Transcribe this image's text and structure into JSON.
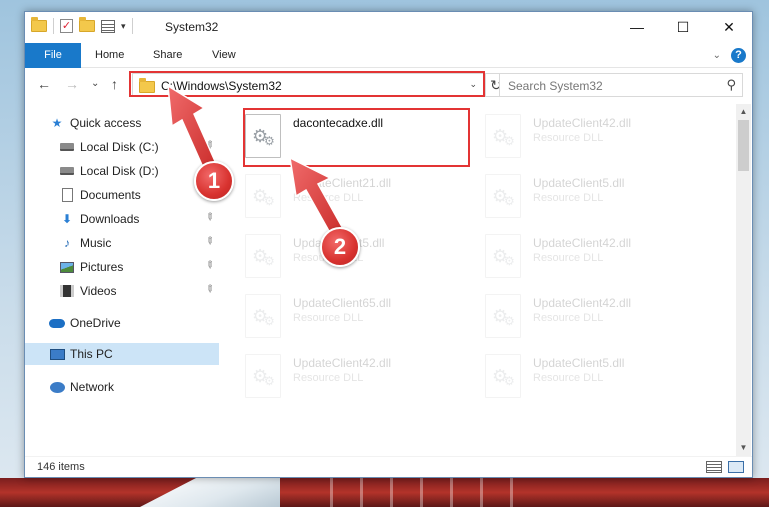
{
  "window": {
    "title": "System32",
    "qat_dropdown": "▾",
    "controls": {
      "minimize": "—",
      "maximize": "☐",
      "close": "✕"
    }
  },
  "ribbon": {
    "tabs": [
      "File",
      "Home",
      "Share",
      "View"
    ],
    "help": "?",
    "expand": "⌄"
  },
  "nav": {
    "back": "←",
    "forward": "→",
    "recent": "⌄",
    "up": "↑",
    "address_path": "C:\\Windows\\System32",
    "address_dropdown": "⌄",
    "refresh": "↻",
    "search_placeholder": "Search System32",
    "search_icon": "⚲"
  },
  "sidebar": {
    "items": [
      {
        "label": "Quick access",
        "icon": "star-icon"
      },
      {
        "label": "Local Disk (C:)",
        "icon": "drive-icon",
        "pinned": true
      },
      {
        "label": "Local Disk (D:)",
        "icon": "drive-icon"
      },
      {
        "label": "Documents",
        "icon": "documents-icon"
      },
      {
        "label": "Downloads",
        "icon": "downloads-icon",
        "pinned": true
      },
      {
        "label": "Music",
        "icon": "music-icon",
        "pinned": true
      },
      {
        "label": "Pictures",
        "icon": "pictures-icon",
        "pinned": true
      },
      {
        "label": "Videos",
        "icon": "videos-icon",
        "pinned": true
      },
      {
        "label": "OneDrive",
        "icon": "onedrive-icon"
      },
      {
        "label": "This PC",
        "icon": "this-pc-icon",
        "selected": true
      },
      {
        "label": "Network",
        "icon": "network-icon"
      }
    ],
    "pin_glyph": "✎"
  },
  "files": {
    "highlighted": {
      "name": "dacontecadxe.dll",
      "type": ""
    },
    "items": [
      {
        "name": "UpdateClient42.dll",
        "type": "Resource DLL"
      },
      {
        "name": "UpdateClient21.dll",
        "type": "Resource DLL"
      },
      {
        "name": "UpdateClient5.dll",
        "type": "Resource DLL"
      },
      {
        "name": "UpdateClient5.dll",
        "type": "Resource DLL"
      },
      {
        "name": "UpdateClient42.dll",
        "type": "Resource DLL"
      },
      {
        "name": "UpdateClient65.dll",
        "type": "Resource DLL"
      },
      {
        "name": "UpdateClient42.dll",
        "type": "Resource DLL"
      },
      {
        "name": "UpdateClient42.dll",
        "type": "Resource DLL"
      },
      {
        "name": "UpdateClient5.dll",
        "type": "Resource DLL"
      }
    ]
  },
  "status": {
    "item_count": "146 items"
  },
  "annotations": {
    "step1": "1",
    "step2": "2",
    "highlight_color": "#e33434"
  }
}
